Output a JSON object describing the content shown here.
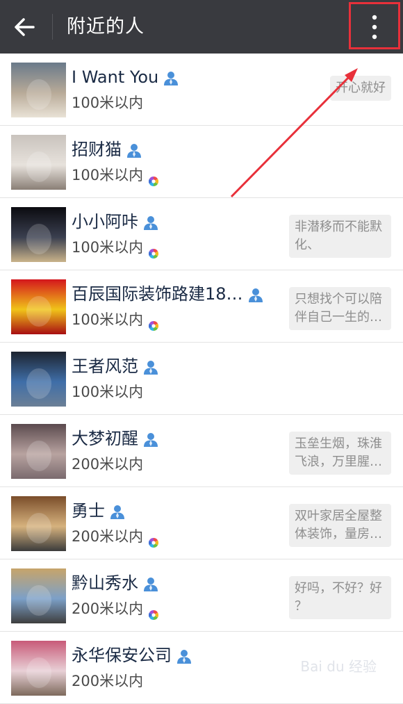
{
  "header": {
    "title": "附近的人",
    "back_icon": "arrow-left-icon",
    "menu_icon": "more-vertical-icon",
    "highlight_color": "#e8303a"
  },
  "people": [
    {
      "name": "I Want You",
      "distance": "100米以内",
      "signature": "开心就好",
      "gender": "male",
      "moments": false
    },
    {
      "name": "招财猫",
      "distance": "100米以内",
      "signature": "",
      "gender": "male",
      "moments": true
    },
    {
      "name": "小小阿咔",
      "distance": "100米以内",
      "signature": "非潜移而不能默化、",
      "gender": "male",
      "moments": true
    },
    {
      "name": "百辰国际装饰路建18…",
      "distance": "100米以内",
      "signature": "只想找个可以陪伴自己一生的…",
      "gender": "male",
      "moments": true
    },
    {
      "name": "王者风范",
      "distance": "100米以内",
      "signature": "",
      "gender": "male",
      "moments": false
    },
    {
      "name": "大梦初醒",
      "distance": "200米以内",
      "signature": "玉垒生烟，珠淮飞浪，万里腥…",
      "gender": "male",
      "moments": false
    },
    {
      "name": "勇士",
      "distance": "200米以内",
      "signature": "双叶家居全屋整体装饰，量房…",
      "gender": "male",
      "moments": true
    },
    {
      "name": "黔山秀水",
      "distance": "200米以内",
      "signature": "好吗，不好？好？",
      "gender": "male",
      "moments": true
    },
    {
      "name": "永华保安公司",
      "distance": "200米以内",
      "signature": "",
      "gender": "male",
      "moments": false
    }
  ],
  "colors": {
    "topbar": "#393a3f",
    "male_icon": "#4a90d9"
  }
}
